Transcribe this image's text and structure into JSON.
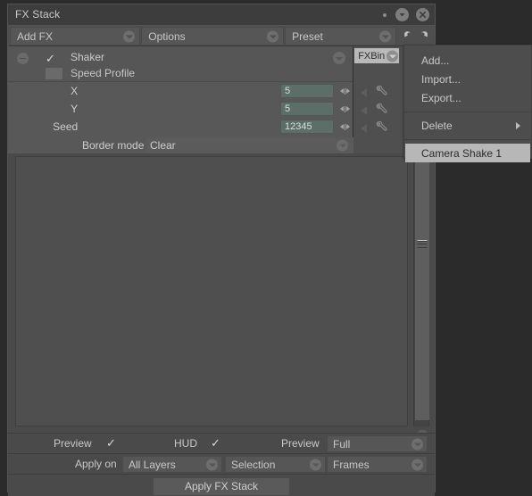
{
  "window": {
    "title": "FX Stack",
    "buttons": [
      {
        "name": "dot-button",
        "glyph": ""
      },
      {
        "name": "minimize-button",
        "glyph": "▼"
      },
      {
        "name": "close-button",
        "glyph": "✕"
      }
    ]
  },
  "toolbar": {
    "add_fx": "Add FX",
    "options": "Options",
    "preset": "Preset",
    "undo": "undo-icon",
    "redo": "redo-icon"
  },
  "fx": {
    "remove_label": "−",
    "enabled_check": "✓",
    "name": "Shaker",
    "speed_profile_label": "Speed Profile",
    "params": [
      {
        "label": "X",
        "value": "5"
      },
      {
        "label": "Y",
        "value": "5"
      },
      {
        "label": "Seed",
        "value": "12345"
      }
    ],
    "border_mode_label": "Border mode",
    "border_mode_value": "Clear",
    "fxbin_label": "FXBin"
  },
  "bottom": {
    "preview_left_label": "Preview",
    "preview_left_check": "✓",
    "hud_label": "HUD",
    "hud_check": "✓",
    "preview_right_label": "Preview",
    "preview_quality": "Full",
    "apply_on_label": "Apply on",
    "apply_on_value": "All Layers",
    "selection_value": "Selection",
    "frames_value": "Frames",
    "apply_button": "Apply FX Stack"
  },
  "menu": {
    "items": [
      {
        "label": "Add...",
        "submenu": false,
        "highlight": false
      },
      {
        "label": "Import...",
        "submenu": false,
        "highlight": false
      },
      {
        "label": "Export...",
        "submenu": false,
        "highlight": false
      }
    ],
    "delete_label": "Delete",
    "preset_entry": "Camera Shake 1"
  },
  "colors": {
    "window_bg": "#4a4a4a",
    "titlebar_bg": "#3d3d3d",
    "field_bg": "#5d6d68",
    "highlight": "#b7b7b7",
    "text": "#c9c9c9"
  }
}
